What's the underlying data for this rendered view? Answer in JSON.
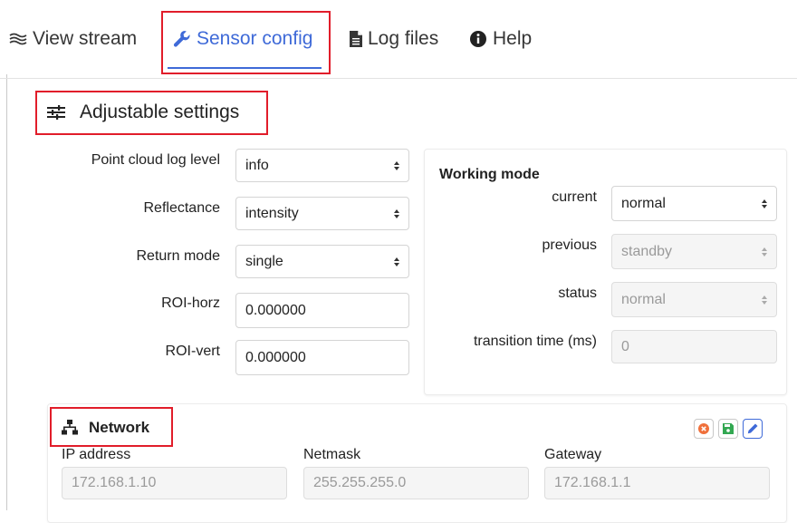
{
  "tabs": [
    {
      "label": "View stream",
      "icon": "stream-icon"
    },
    {
      "label": "Sensor config",
      "icon": "wrench-icon",
      "active": true
    },
    {
      "label": "Log files",
      "icon": "file-icon"
    },
    {
      "label": "Help",
      "icon": "info-circle-icon"
    }
  ],
  "adjustable": {
    "title": "Adjustable settings",
    "point_cloud_log_level": {
      "label": "Point cloud log level",
      "value": "info"
    },
    "reflectance": {
      "label": "Reflectance",
      "value": "intensity"
    },
    "return_mode": {
      "label": "Return mode",
      "value": "single"
    },
    "roi_horz": {
      "label": "ROI-horz",
      "value": "0.000000"
    },
    "roi_vert": {
      "label": "ROI-vert",
      "value": "0.000000"
    }
  },
  "working_mode": {
    "title": "Working mode",
    "current": {
      "label": "current",
      "value": "normal"
    },
    "previous": {
      "label": "previous",
      "value": "standby"
    },
    "status": {
      "label": "status",
      "value": "normal"
    },
    "transition_time": {
      "label": "transition time (ms)",
      "value": "0"
    }
  },
  "network": {
    "title": "Network",
    "ip": {
      "label": "IP address",
      "value": "172.168.1.10"
    },
    "netmask": {
      "label": "Netmask",
      "value": "255.255.255.0"
    },
    "gateway": {
      "label": "Gateway",
      "value": "172.168.1.1"
    }
  },
  "colors": {
    "accent": "#3f6ad8",
    "highlight": "#e11d2a",
    "cancel": "#f0703b",
    "save": "#33a852",
    "edit": "#3f6ad8"
  }
}
